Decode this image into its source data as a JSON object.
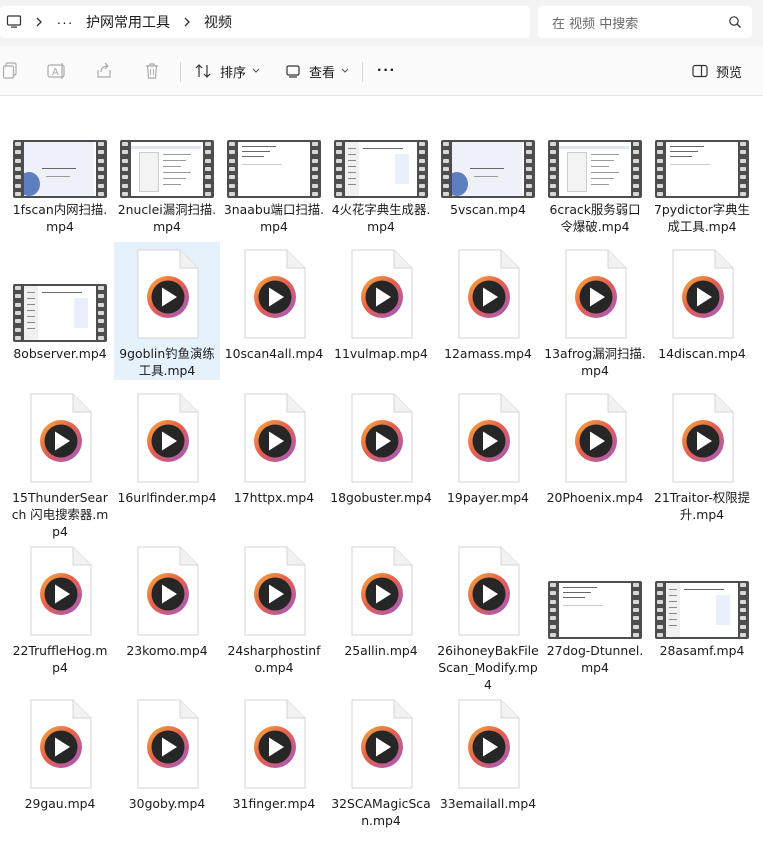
{
  "address": {
    "root_icon": "computer-icon",
    "more": "···",
    "crumbs": [
      "护网常用工具",
      "视频"
    ]
  },
  "search": {
    "placeholder": "在 视频 中搜索",
    "icon": "search-icon"
  },
  "toolbar": {
    "buttons": [
      {
        "name": "copy-button",
        "icon": "copy-icon"
      },
      {
        "name": "rename-button",
        "icon": "rename-icon"
      },
      {
        "name": "share-button",
        "icon": "share-icon"
      },
      {
        "name": "delete-button",
        "icon": "trash-icon"
      }
    ],
    "sort_label": "排序",
    "view_label": "查看",
    "more": "···",
    "preview_label": "预览"
  },
  "files": [
    {
      "name": "1fscan内网扫描.mp4",
      "thumb": "film"
    },
    {
      "name": "2nuclei漏洞扫描.mp4",
      "thumb": "film"
    },
    {
      "name": "3naabu端口扫描.mp4",
      "thumb": "film"
    },
    {
      "name": "4火花字典生成器.mp4",
      "thumb": "film"
    },
    {
      "name": "5vscan.mp4",
      "thumb": "film"
    },
    {
      "name": "6crack服务弱口令爆破.mp4",
      "thumb": "film"
    },
    {
      "name": "7pydictor字典生成工具.mp4",
      "thumb": "film"
    },
    {
      "name": "8observer.mp4",
      "thumb": "film"
    },
    {
      "name": "9goblin钓鱼演练工具.mp4",
      "thumb": "video",
      "selected": true
    },
    {
      "name": "10scan4all.mp4",
      "thumb": "video"
    },
    {
      "name": "11vulmap.mp4",
      "thumb": "video"
    },
    {
      "name": "12amass.mp4",
      "thumb": "video"
    },
    {
      "name": "13afrog漏洞扫描.mp4",
      "thumb": "video"
    },
    {
      "name": "14discan.mp4",
      "thumb": "video"
    },
    {
      "name": "15ThunderSearch 闪电搜索器.mp4",
      "thumb": "video"
    },
    {
      "name": "16urlfinder.mp4",
      "thumb": "video"
    },
    {
      "name": "17httpx.mp4",
      "thumb": "video"
    },
    {
      "name": "18gobuster.mp4",
      "thumb": "video"
    },
    {
      "name": "19payer.mp4",
      "thumb": "video"
    },
    {
      "name": "20Phoenix.mp4",
      "thumb": "video"
    },
    {
      "name": "21Traitor-权限提升.mp4",
      "thumb": "video"
    },
    {
      "name": "22TruffleHog.mp4",
      "thumb": "video"
    },
    {
      "name": "23komo.mp4",
      "thumb": "video"
    },
    {
      "name": "24sharphostinfo.mp4",
      "thumb": "video"
    },
    {
      "name": "25allin.mp4",
      "thumb": "video"
    },
    {
      "name": "26ihoneyBakFileScan_Modify.mp4",
      "thumb": "video"
    },
    {
      "name": "27dog-Dtunnel.mp4",
      "thumb": "film"
    },
    {
      "name": "28asamf.mp4",
      "thumb": "film"
    },
    {
      "name": "29gau.mp4",
      "thumb": "video"
    },
    {
      "name": "30goby.mp4",
      "thumb": "video"
    },
    {
      "name": "31finger.mp4",
      "thumb": "video"
    },
    {
      "name": "32SCAMagicScan.mp4",
      "thumb": "video"
    },
    {
      "name": "33emailall.mp4",
      "thumb": "video"
    }
  ],
  "colors": {
    "selection": "#e5f1fb",
    "play_ring_start": "#f2a33a",
    "play_ring_end": "#9b59d0",
    "film_frame": "#4d4d4d"
  }
}
